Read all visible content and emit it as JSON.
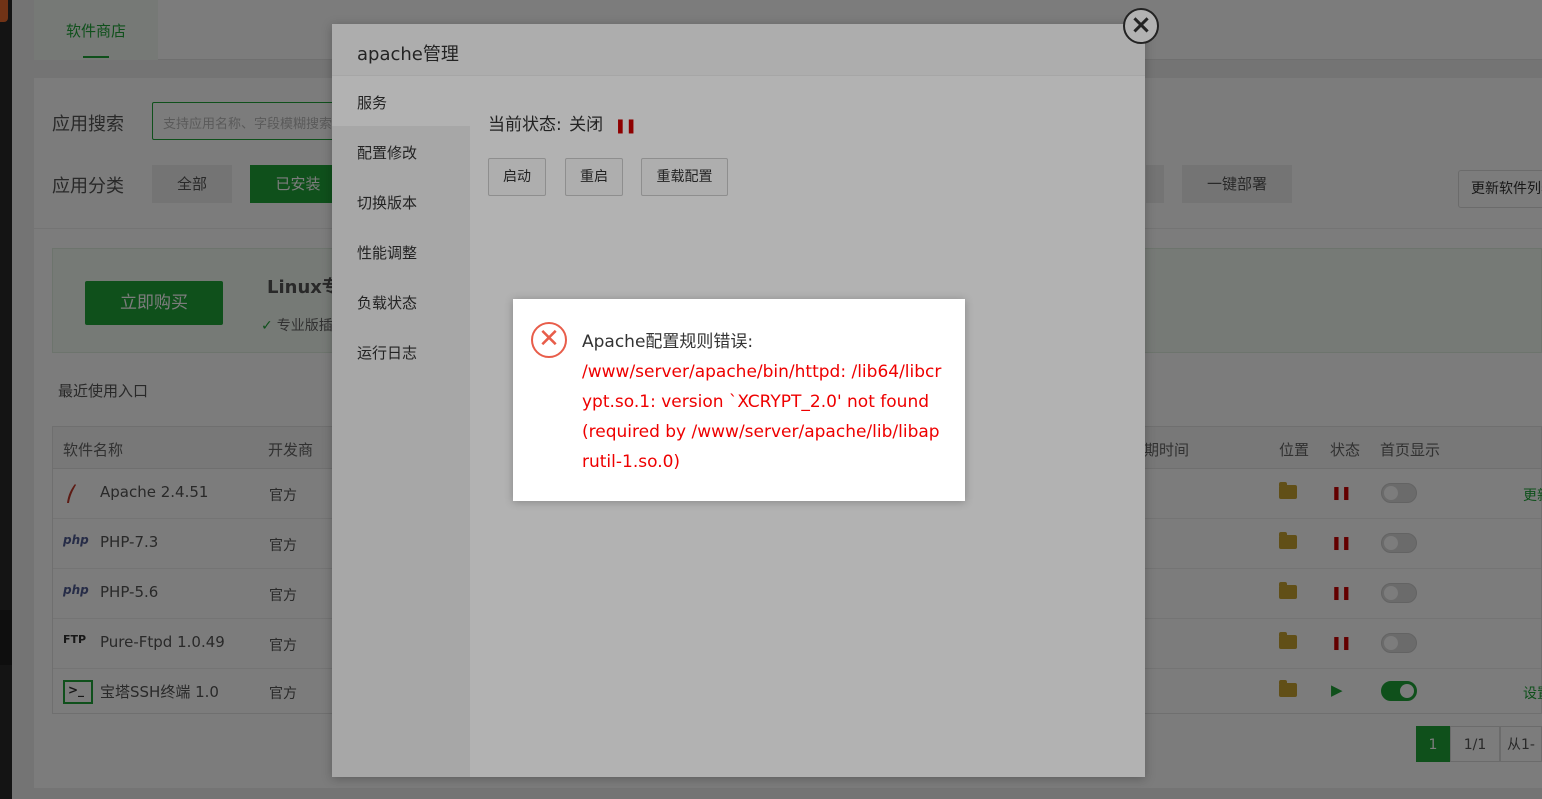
{
  "topbar": {
    "tab_label": "软件商店"
  },
  "search": {
    "label": "应用搜索",
    "placeholder": "支持应用名称、字段模糊搜索"
  },
  "categories": {
    "label": "应用分类",
    "items": [
      "全部",
      "已安装",
      "一键部署"
    ],
    "update_label": "更新软件列表"
  },
  "promo": {
    "buy_label": "立即购买",
    "title": "Linux专业版",
    "check_text": "专业版插件"
  },
  "recent_label": "最近使用入口",
  "table": {
    "headers": {
      "name": "软件名称",
      "developer": "开发商",
      "expire": "到期时间",
      "location": "位置",
      "status": "状态",
      "home": "首页显示"
    },
    "rows": [
      {
        "icon": "apache-icon",
        "name": "Apache 2.4.51",
        "developer": "官方",
        "state": "stopped",
        "home": false,
        "op": "更新"
      },
      {
        "icon": "php-icon",
        "name": "PHP-7.3",
        "developer": "官方",
        "state": "stopped",
        "home": false,
        "op": ""
      },
      {
        "icon": "php-icon",
        "name": "PHP-5.6",
        "developer": "官方",
        "state": "stopped",
        "home": false,
        "op": ""
      },
      {
        "icon": "ftp-icon",
        "name": "Pure-Ftpd 1.0.49",
        "developer": "官方",
        "state": "stopped",
        "home": false,
        "op": ""
      },
      {
        "icon": "terminal-icon",
        "name": "宝塔SSH终端 1.0",
        "developer": "官方",
        "state": "running",
        "home": true,
        "op": "设置"
      }
    ],
    "icon_labels": {
      "php": "php",
      "ftp": "FTP",
      "terminal": ">_"
    },
    "state_glyphs": {
      "stopped": "❚❚",
      "running": "▶"
    }
  },
  "pagination": {
    "current": "1",
    "total": "1/1",
    "range": "从1-"
  },
  "modal": {
    "title": "apache管理",
    "close_glyph": "×",
    "nav": [
      "服务",
      "配置修改",
      "切换版本",
      "性能调整",
      "负载状态",
      "运行日志"
    ],
    "status_label": "当前状态:",
    "status_value": "关闭",
    "status_glyph": "❚❚",
    "buttons": [
      "启动",
      "重启",
      "重载配置"
    ]
  },
  "error": {
    "icon_glyph": "✕",
    "title": "Apache配置规则错误:",
    "detail": "/www/server/apache/bin/httpd: /lib64/libcrypt.so.1: version `XCRYPT_2.0' not found (required by /www/server/apache/lib/libaprutil-1.so.0)"
  },
  "colors": {
    "accent": "#20a53a",
    "error": "#e00000",
    "stopped": "#cc0000"
  }
}
